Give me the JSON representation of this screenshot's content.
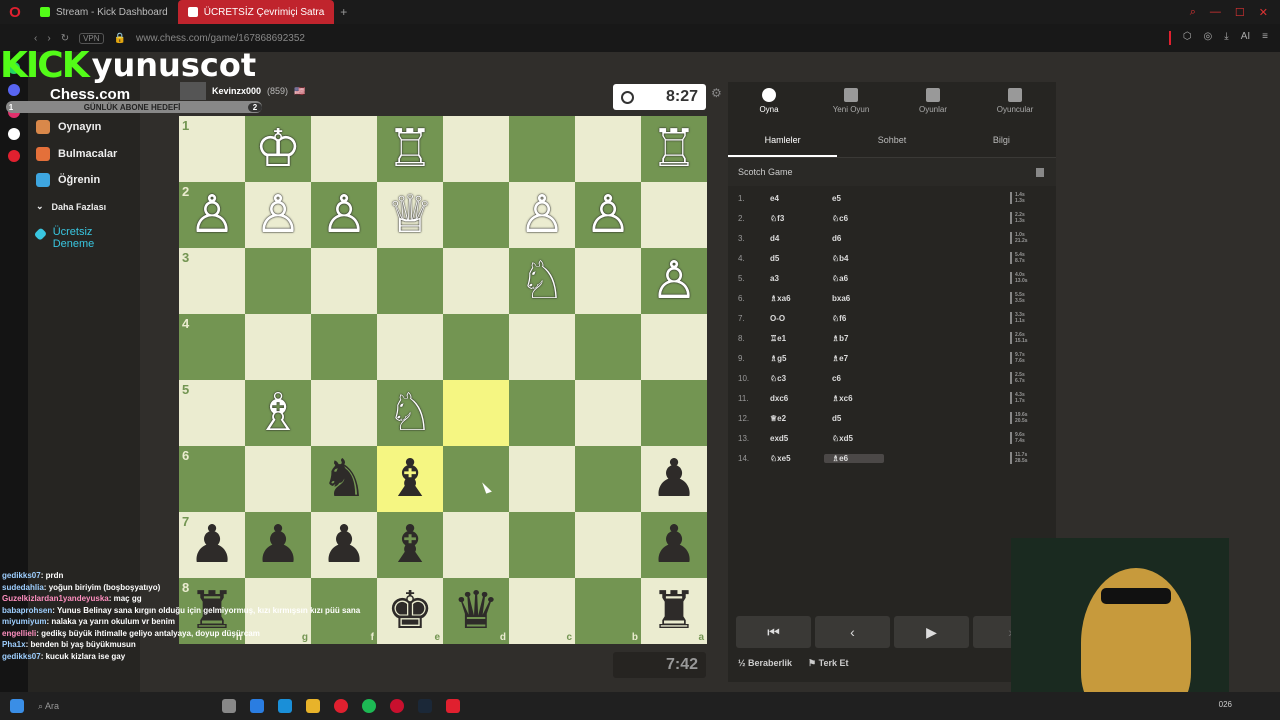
{
  "browser": {
    "tabs": [
      {
        "label": "Stream - Kick Dashboard",
        "active": false
      },
      {
        "label": "ÜCRETSİZ Çevrimiçi Satra",
        "active": true
      }
    ],
    "vpn": "VPN",
    "url": "www.chess.com/game/167868692352",
    "ai_label": "AI"
  },
  "overlay": {
    "kick_logo": "KICK",
    "streamer": "yunuscot",
    "goal_label": "GÜNLÜK ABONE HEDEFİ",
    "goal_left": "1",
    "goal_right": "2"
  },
  "sidebar": {
    "logo": "Chess.com",
    "items": [
      {
        "label": "Oynayın",
        "color": "#d9884a"
      },
      {
        "label": "Bulmacalar",
        "color": "#e4703a"
      },
      {
        "label": "Öğrenin",
        "color": "#3ea6e0"
      },
      {
        "label": "Daha Fazlası",
        "color": "#888888"
      },
      {
        "label": "Ücretsiz Deneme",
        "color": "#39c6e0"
      }
    ]
  },
  "opponent": {
    "name": "Kevinzx000",
    "rating": "(859)",
    "clock": "8:27"
  },
  "self_clock": "7:42",
  "board": {
    "ranks": [
      "1",
      "2",
      "3",
      "4",
      "5",
      "6",
      "7",
      "8"
    ],
    "files": [
      "h",
      "g",
      "f",
      "e",
      "d",
      "c",
      "b",
      "a"
    ],
    "squares": [
      [
        "",
        "♔",
        "",
        "♖",
        "",
        "",
        "",
        "♖"
      ],
      [
        "♙",
        "♙",
        "♙",
        "♕",
        "",
        "♙",
        "♙",
        ""
      ],
      [
        "",
        "",
        "",
        "",
        "",
        "♘",
        "",
        "♙"
      ],
      [
        "",
        "",
        "",
        "",
        "",
        "",
        "",
        ""
      ],
      [
        "",
        "♗",
        "",
        "♘",
        "",
        "",
        "",
        ""
      ],
      [
        "",
        "",
        "♞",
        "♝",
        "",
        "",
        "",
        "♟"
      ],
      [
        "♟",
        "♟",
        "♟",
        "♝",
        "",
        "",
        "",
        "♟"
      ],
      [
        "♜",
        "",
        "",
        "♚",
        "♛",
        "",
        "",
        "♜"
      ]
    ],
    "colors": [
      [
        "",
        "w",
        "",
        "w",
        "",
        "",
        "",
        "w"
      ],
      [
        "w",
        "w",
        "w",
        "w",
        "",
        "w",
        "w",
        ""
      ],
      [
        "",
        "",
        "",
        "",
        "",
        "w",
        "",
        "w"
      ],
      [
        "",
        "",
        "",
        "",
        "",
        "",
        "",
        ""
      ],
      [
        "",
        "w",
        "",
        "w",
        "",
        "",
        "",
        ""
      ],
      [
        "",
        "",
        "b",
        "b",
        "",
        "",
        "",
        "b"
      ],
      [
        "b",
        "b",
        "b",
        "b",
        "",
        "",
        "",
        "b"
      ],
      [
        "b",
        "",
        "",
        "b",
        "b",
        "",
        "",
        "b"
      ]
    ],
    "highlights": [
      "4-4",
      "5-3"
    ]
  },
  "panel": {
    "tabs": [
      "Oyna",
      "Yeni Oyun",
      "Oyunlar",
      "Oyuncular"
    ],
    "subtabs": [
      "Hamleler",
      "Sohbet",
      "Bilgi"
    ],
    "opening": "Scotch Game",
    "moves": [
      {
        "n": "1.",
        "w": "e4",
        "b": "e5",
        "t1": "1.4s",
        "t2": "1.3s"
      },
      {
        "n": "2.",
        "w": "♘f3",
        "b": "♘c6",
        "t1": "2.2s",
        "t2": "1.3s"
      },
      {
        "n": "3.",
        "w": "d4",
        "b": "d6",
        "t1": "1.0s",
        "t2": "21.2s"
      },
      {
        "n": "4.",
        "w": "d5",
        "b": "♘b4",
        "t1": "5.4s",
        "t2": "8.7s"
      },
      {
        "n": "5.",
        "w": "a3",
        "b": "♘a6",
        "t1": "4.0s",
        "t2": "13.0s"
      },
      {
        "n": "6.",
        "w": "♗xa6",
        "b": "bxa6",
        "t1": "5.5s",
        "t2": "3.5s"
      },
      {
        "n": "7.",
        "w": "O-O",
        "b": "♘f6",
        "t1": "3.3s",
        "t2": "1.1s"
      },
      {
        "n": "8.",
        "w": "♖e1",
        "b": "♗b7",
        "t1": "2.6s",
        "t2": "15.1s"
      },
      {
        "n": "9.",
        "w": "♗g5",
        "b": "♗e7",
        "t1": "9.7s",
        "t2": "7.6s"
      },
      {
        "n": "10.",
        "w": "♘c3",
        "b": "c6",
        "t1": "2.5s",
        "t2": "6.7s"
      },
      {
        "n": "11.",
        "w": "dxc6",
        "b": "♗xc6",
        "t1": "4.3s",
        "t2": "1.7s"
      },
      {
        "n": "12.",
        "w": "♕e2",
        "b": "d5",
        "t1": "19.6s",
        "t2": "20.5s"
      },
      {
        "n": "13.",
        "w": "exd5",
        "b": "♘xd5",
        "t1": "9.6s",
        "t2": "7.4s"
      },
      {
        "n": "14.",
        "w": "♘xe5",
        "b": "♗e6",
        "t1": "11.7s",
        "t2": "28.5s"
      }
    ],
    "controls": [
      "⏮",
      "‹",
      "▶",
      "›"
    ],
    "draw": "Beraberlik",
    "resign": "Terk Et"
  },
  "chat": [
    {
      "user": "gedikks07",
      "msg": "prdn"
    },
    {
      "user": "sudedahlia",
      "msg": "yoğun biriyim (boşboşyatıyo)"
    },
    {
      "user": "Guzelkizlardan1yandeyuska",
      "msg": "maç gg"
    },
    {
      "user": "babaprohsen",
      "msg": "Yunus Belinay sana kırgın olduğu için gelmiyormuş, kızı kırmışsın kızı püü sana"
    },
    {
      "user": "miyumiyum",
      "msg": "nalaka ya yarın okulum vr benim"
    },
    {
      "user": "engellieli",
      "msg": "gedikş büyük ihtimalle geliyo antalyaya, doyup düşürcam"
    },
    {
      "user": "Pha1x",
      "msg": "benden bi yaş büyükmusun"
    },
    {
      "user": "gedikks07",
      "msg": "kucuk kizlara ise gay"
    }
  ],
  "taskbar": {
    "search": "Ara",
    "time": "026"
  }
}
